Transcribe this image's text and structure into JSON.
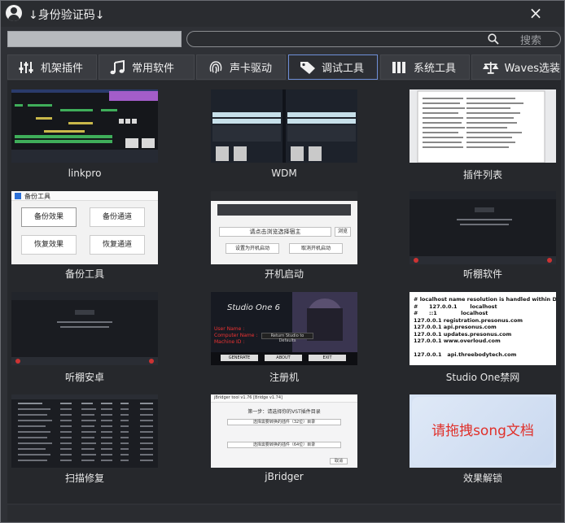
{
  "window": {
    "title": "↓身份验证码↓",
    "close_glyph": "×"
  },
  "search": {
    "button_label": "搜索"
  },
  "tabs": [
    {
      "label": "机架插件",
      "icon": "sliders-icon"
    },
    {
      "label": "常用软件",
      "icon": "music-note-icon"
    },
    {
      "label": "声卡驱动",
      "icon": "fingerprint-icon"
    },
    {
      "label": "调试工具",
      "icon": "tag-icon",
      "active": true
    },
    {
      "label": "系统工具",
      "icon": "columns-icon"
    },
    {
      "label": "Waves选装",
      "icon": "scale-icon"
    }
  ],
  "tiles": [
    {
      "label": "linkpro"
    },
    {
      "label": "WDM"
    },
    {
      "label": "插件列表"
    },
    {
      "label": "备份工具"
    },
    {
      "label": "开机启动"
    },
    {
      "label": "听棚软件"
    },
    {
      "label": "听棚安卓"
    },
    {
      "label": "注册机"
    },
    {
      "label": "Studio One禁网"
    },
    {
      "label": "扫描修复"
    },
    {
      "label": "jBridger"
    },
    {
      "label": "效果解锁"
    }
  ],
  "thumbnails": {
    "backup": {
      "title": "备份工具",
      "buttons": [
        "备份效果",
        "备份通道",
        "恢复效果",
        "恢复通道"
      ]
    },
    "boot": {
      "header": "请点击浏览选择宿主",
      "browse": "浏览",
      "btn_set": "设置为开机启动",
      "btn_cancel": "取消开机启动"
    },
    "hosts": {
      "lines": [
        "# localhost name resolution is handled within DNS itself.",
        "#      127.0.0.1       localhost",
        "#      ::1             localhost",
        "127.0.0.1 registration.presonus.com",
        "127.0.0.1 api.presonus.com",
        "127.0.0.1 updates.presonus.com",
        "127.0.0.1 www.overloud.com",
        "",
        "127.0.0.1   api.threebodytech.com"
      ]
    },
    "registration": {
      "brand": "Studio One 6",
      "field_labels": [
        "User Name :",
        "Computer Name :",
        "Machine ID :"
      ],
      "field_value": "Return Studio to Defaults",
      "buttons": [
        "GENERATE",
        "ABOUT",
        "EXIT"
      ]
    },
    "jbridger": {
      "title": "jBridger tool v1.76 [Bridge v1.74]",
      "step": "第一步：请选择你的VST插件目录",
      "btn1": "选择需要转换的插件（32位）目录",
      "btn2": "选择需要转换的插件（64位）目录",
      "cancel": "取消"
    },
    "effect": {
      "text": "请拖拽song文档"
    }
  },
  "colors": {
    "accent": "#6f8fd8",
    "window_bg": "#2f3136",
    "panel_bg": "#26282c",
    "effect_text": "#e0302a"
  }
}
